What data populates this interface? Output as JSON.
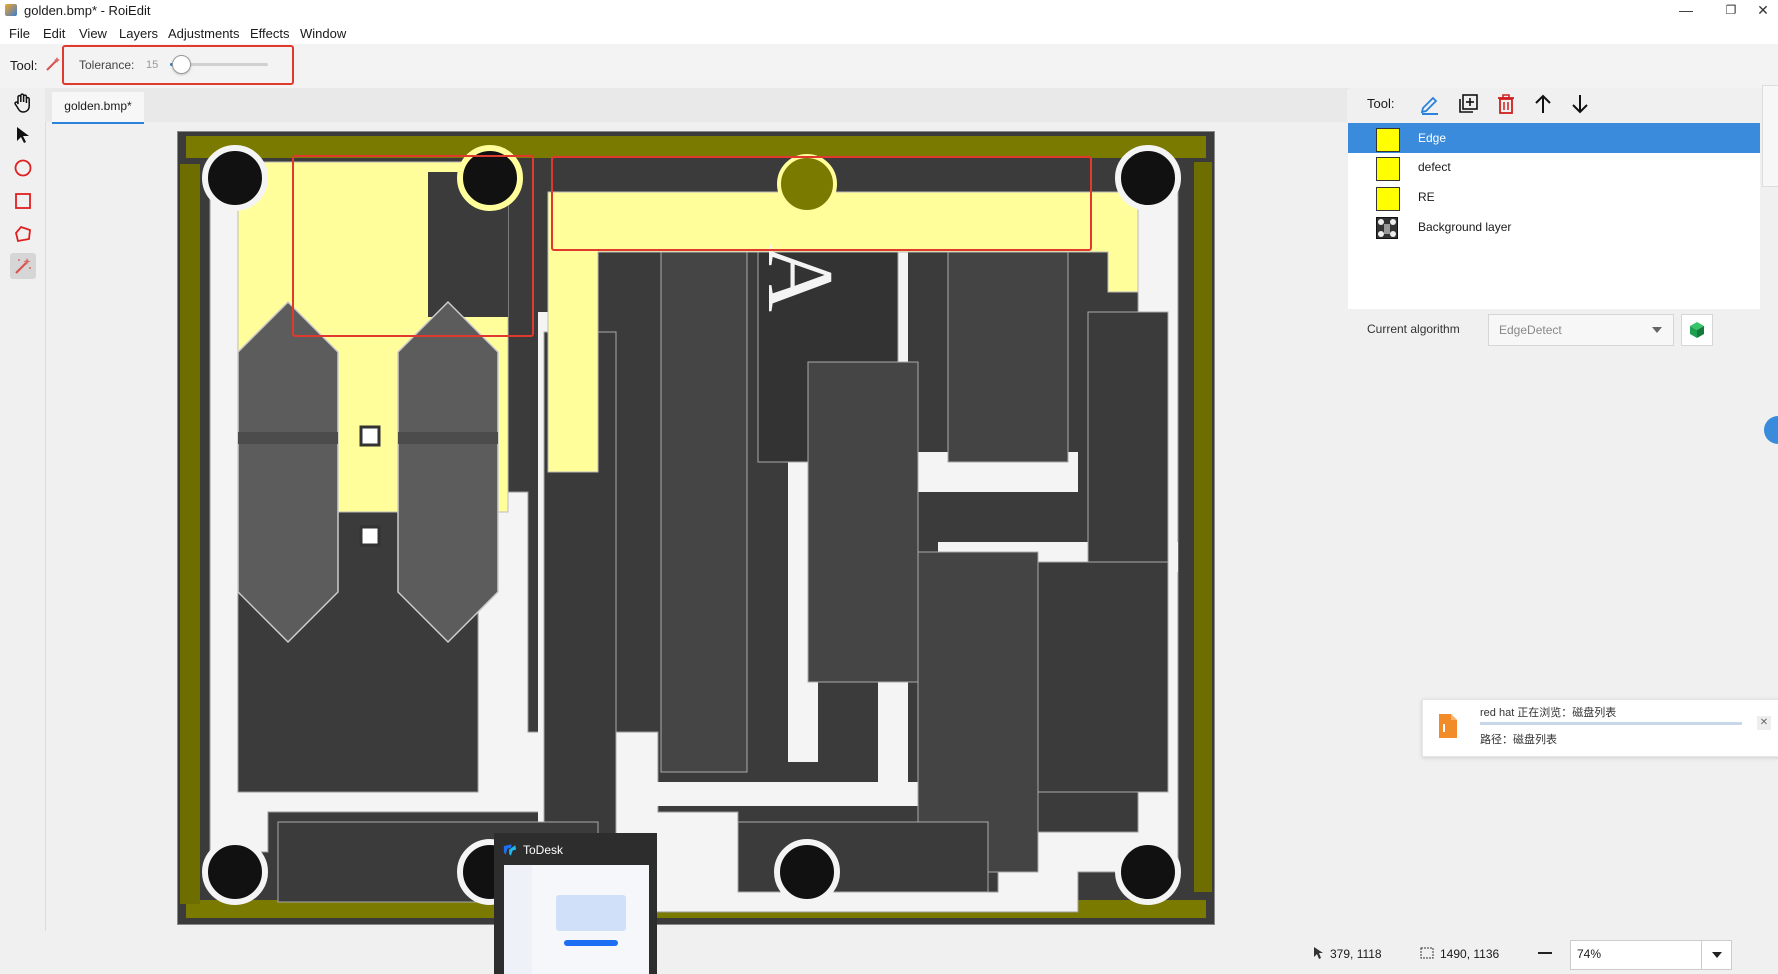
{
  "window": {
    "title": "golden.bmp* - RoiEdit",
    "minimize": "—",
    "restore": "❐",
    "close": "✕"
  },
  "menu": [
    "File",
    "Edit",
    "View",
    "Layers",
    "Adjustments",
    "Effects",
    "Window"
  ],
  "toolbar": {
    "tool_label": "Tool:",
    "tolerance_label": "Tolerance:",
    "tolerance_value": "15",
    "tolerance_fraction": 0.1
  },
  "document": {
    "tab_label": "golden.bmp*",
    "annotation_letter": "A"
  },
  "layers_panel": {
    "tool_label": "Tool:",
    "layers": [
      {
        "name": "Edge",
        "color": "#ffff00",
        "selected": true
      },
      {
        "name": "defect",
        "color": "#ffff00",
        "selected": false
      },
      {
        "name": "RE",
        "color": "#ffff00",
        "selected": false
      },
      {
        "name": "Background layer",
        "color": null,
        "selected": false
      }
    ],
    "algorithm_label": "Current algorithm",
    "algorithm_value": "EdgeDetect"
  },
  "status": {
    "cursor_pos": "379, 1118",
    "image_size": "1490, 1136",
    "zoom": "74%"
  },
  "notification": {
    "line1": "red hat 正在浏览：磁盘列表",
    "line2": "路径：磁盘列表"
  },
  "todesk": {
    "title": "ToDesk"
  },
  "colors": {
    "accent": "#2a82da",
    "highlight": "#e03a2f",
    "roi_yellow": "#fffe9a",
    "layer_yellow": "#ffff00"
  }
}
